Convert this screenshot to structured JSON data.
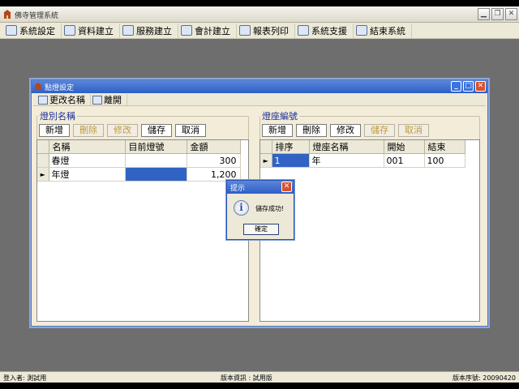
{
  "app": {
    "title": "佛寺管理系統"
  },
  "menu": [
    {
      "label": "系統設定",
      "icon": "gear-icon"
    },
    {
      "label": "資料建立",
      "icon": "data-icon"
    },
    {
      "label": "服務建立",
      "icon": "service-icon"
    },
    {
      "label": "會計建立",
      "icon": "accounting-icon"
    },
    {
      "label": "報表列印",
      "icon": "print-icon"
    },
    {
      "label": "系統支援",
      "icon": "support-icon"
    },
    {
      "label": "結束系統",
      "icon": "exit-icon"
    }
  ],
  "dialog": {
    "title": "點燈設定",
    "toolbar": [
      {
        "label": "更改名稱",
        "icon": "rename-icon"
      },
      {
        "label": "離開",
        "icon": "exit-icon"
      }
    ],
    "left": {
      "title": "燈別名稱",
      "buttons": [
        "新增",
        "刪除",
        "修改",
        "儲存",
        "取消"
      ],
      "columns": [
        "名稱",
        "目前燈號",
        "金額"
      ],
      "rows": [
        {
          "name": "春燈",
          "current": "",
          "amount": "300"
        },
        {
          "name": "年燈",
          "current": "",
          "amount": "1,200"
        }
      ]
    },
    "right": {
      "title": "燈座編號",
      "buttons": [
        "新增",
        "刪除",
        "修改",
        "儲存",
        "取消"
      ],
      "columns": [
        "排序",
        "燈座名稱",
        "開始",
        "結束"
      ],
      "rows": [
        {
          "order": "1",
          "name": "年",
          "start": "001",
          "end": "100"
        }
      ]
    }
  },
  "msgbox": {
    "title": "提示",
    "message": "儲存成功!",
    "ok": "確定"
  },
  "status": {
    "user": "登入者: 測試用",
    "version": "版本資訊 : 試用版",
    "serial": "版本序號: 20090420"
  }
}
